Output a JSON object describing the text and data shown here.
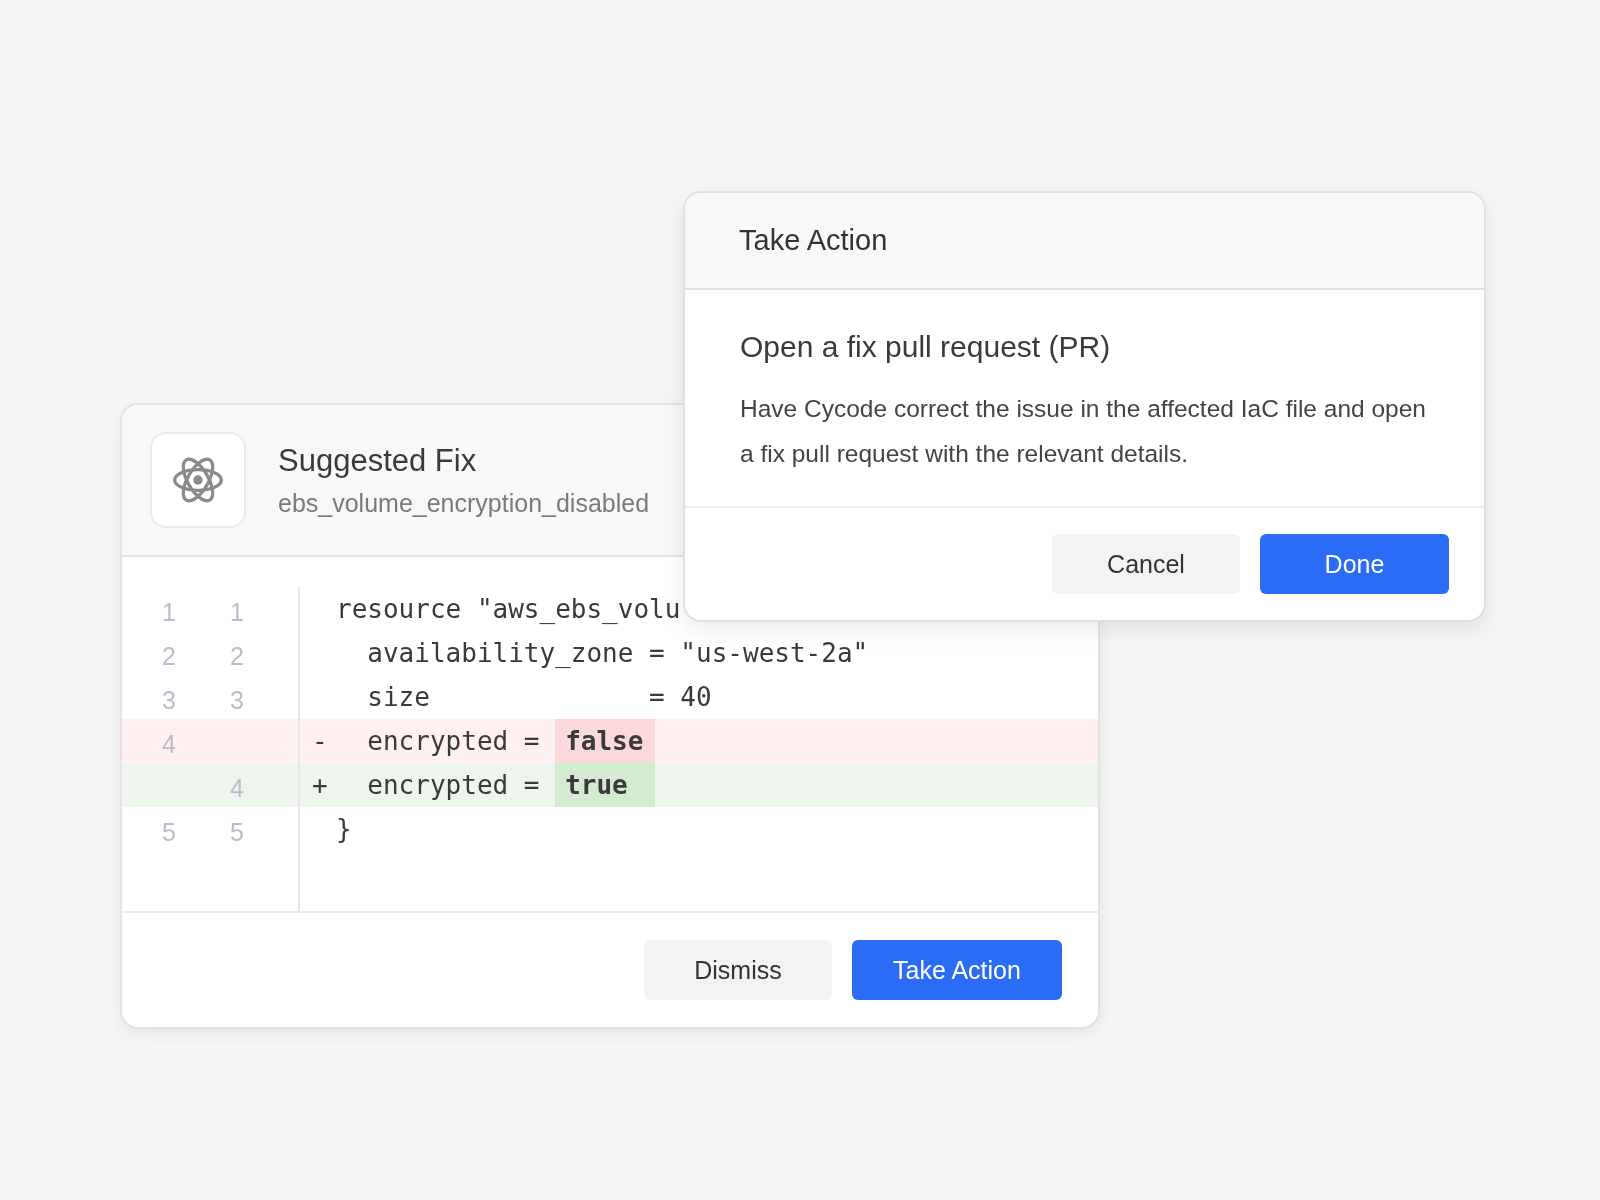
{
  "suggested_fix": {
    "title": "Suggested Fix",
    "subtitle": "ebs_volume_encryption_disabled",
    "diff": [
      {
        "kind": "context",
        "old": "1",
        "new": "1",
        "code": "resource \"aws_ebs_volu"
      },
      {
        "kind": "context",
        "old": "2",
        "new": "2",
        "code": "  availability_zone = \"us-west-2a\""
      },
      {
        "kind": "context",
        "old": "3",
        "new": "3",
        "code": "  size              = 40"
      },
      {
        "kind": "removed",
        "old": "4",
        "sign": "-",
        "code": "  encrypted = ",
        "highlight": "false"
      },
      {
        "kind": "added",
        "new": "4",
        "sign": "+",
        "code": "  encrypted = ",
        "highlight": "true"
      },
      {
        "kind": "context",
        "old": "5",
        "new": "5",
        "code": "}"
      }
    ],
    "buttons": [
      {
        "label": "Dismiss",
        "kind": "secondary"
      },
      {
        "label": "Take Action",
        "kind": "primary"
      }
    ]
  },
  "dialog": {
    "title": "Take Action",
    "heading": "Open a fix pull request (PR)",
    "text": "Have Cycode correct the issue in the affected IaC file and open a fix pull request with the relevant details.",
    "buttons": [
      {
        "label": "Cancel",
        "kind": "secondary"
      },
      {
        "label": "Done",
        "kind": "primary"
      }
    ]
  }
}
